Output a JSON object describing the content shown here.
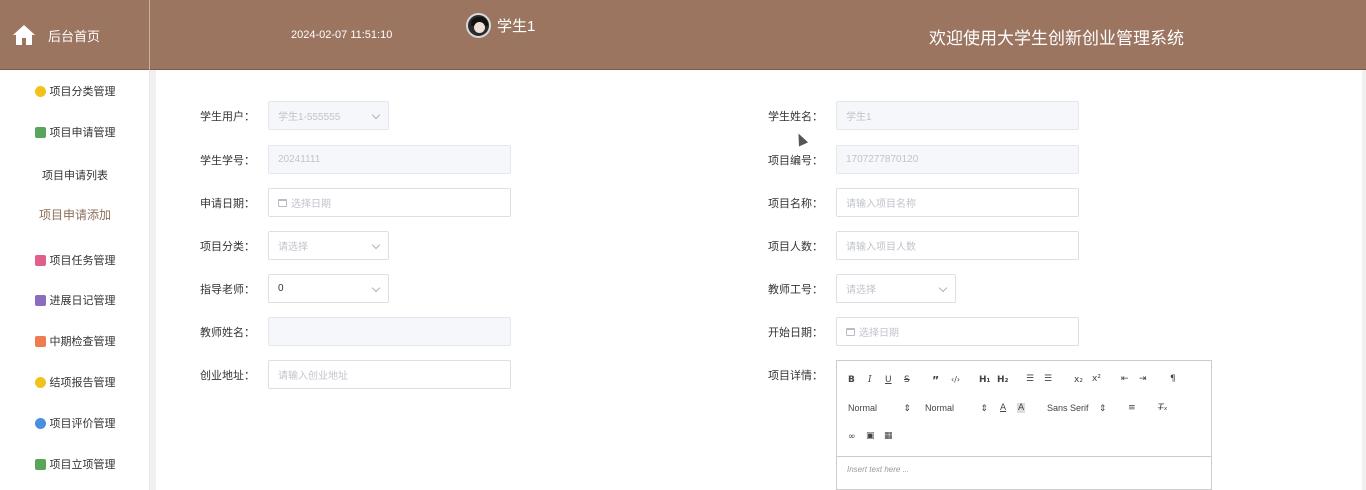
{
  "header": {
    "brand_label": "后台首页",
    "datetime": "2024-02-07 11:51:10",
    "user_name": "学生1",
    "site_title": "欢迎使用大学生创新创业管理系统"
  },
  "sidebar": {
    "items": [
      {
        "label": "项目分类管理",
        "icon": "box-icon",
        "color": "#f3c21a"
      },
      {
        "label": "项目申请管理",
        "icon": "chat-icon",
        "color": "#5aa55a"
      },
      {
        "label": "项目申请列表"
      },
      {
        "label": "项目申请添加"
      },
      {
        "label": "项目任务管理",
        "icon": "clipboard-icon",
        "color": "#e0608a"
      },
      {
        "label": "进展日记管理",
        "icon": "book-icon",
        "color": "#8a6dbf"
      },
      {
        "label": "中期检查管理",
        "icon": "grid-icon",
        "color": "#ef7b4f"
      },
      {
        "label": "结项报告管理",
        "icon": "box-icon",
        "color": "#f3c21a"
      },
      {
        "label": "项目评价管理",
        "icon": "star-icon",
        "color": "#4a8fe0"
      },
      {
        "label": "项目立项管理",
        "icon": "chat-icon",
        "color": "#5aa55a"
      }
    ]
  },
  "form": {
    "student_user": {
      "label": "学生用户：",
      "value": "学生1-555555"
    },
    "student_name": {
      "label": "学生姓名：",
      "value": "学生1"
    },
    "student_no": {
      "label": "学生学号：",
      "value": "20241111"
    },
    "project_no": {
      "label": "项目编号：",
      "value": "1707277870120"
    },
    "apply_date": {
      "label": "申请日期：",
      "placeholder": "选择日期"
    },
    "project_name": {
      "label": "项目名称：",
      "placeholder": "请输入项目名称"
    },
    "project_category": {
      "label": "项目分类：",
      "placeholder": "请选择"
    },
    "project_members": {
      "label": "项目人数：",
      "placeholder": "请输入项目人数"
    },
    "advisor": {
      "label": "指导老师：",
      "value": "0"
    },
    "teacher_no": {
      "label": "教师工号：",
      "placeholder": "请选择"
    },
    "teacher_name": {
      "label": "教师姓名：",
      "value": ""
    },
    "start_date": {
      "label": "开始日期：",
      "placeholder": "选择日期"
    },
    "address": {
      "label": "创业地址：",
      "placeholder": "请输入创业地址"
    },
    "details": {
      "label": "项目详情："
    }
  },
  "editor": {
    "header_select": "Normal",
    "size_select": "Normal",
    "font_select": "Sans Serif",
    "placeholder": "Insert text here ..."
  },
  "colors": {
    "header_bg": "#9b7560",
    "active_menu_text": "#8e6e5c"
  }
}
